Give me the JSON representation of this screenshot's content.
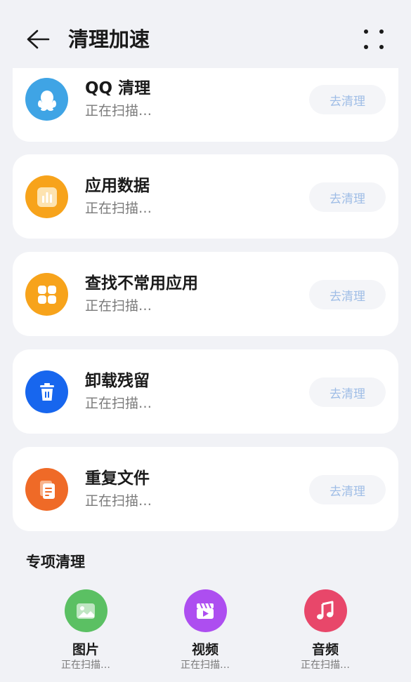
{
  "header": {
    "title": "清理加速"
  },
  "cards": [
    {
      "title": "QQ 清理",
      "status": "正在扫描…",
      "button": "去清理",
      "icon": "qq-penguin-icon",
      "color": "#3fa4e5"
    },
    {
      "title": "应用数据",
      "status": "正在扫描…",
      "button": "去清理",
      "icon": "bar-chart-icon",
      "color": "#f7a31b"
    },
    {
      "title": "查找不常用应用",
      "status": "正在扫描…",
      "button": "去清理",
      "icon": "app-grid-icon",
      "color": "#f7a31b"
    },
    {
      "title": "卸载残留",
      "status": "正在扫描…",
      "button": "去清理",
      "icon": "trash-icon",
      "color": "#1766ee"
    },
    {
      "title": "重复文件",
      "status": "正在扫描…",
      "button": "去清理",
      "icon": "duplicate-file-icon",
      "color": "#ef6a27"
    }
  ],
  "special": {
    "title": "专项清理",
    "items": [
      {
        "label": "图片",
        "status": "正在扫描…",
        "icon": "image-icon",
        "color": "#5bc063"
      },
      {
        "label": "视频",
        "status": "正在扫描…",
        "icon": "video-clapper-icon",
        "color": "#ad4ef0"
      },
      {
        "label": "音频",
        "status": "正在扫描…",
        "icon": "music-note-icon",
        "color": "#e8476a"
      }
    ]
  }
}
